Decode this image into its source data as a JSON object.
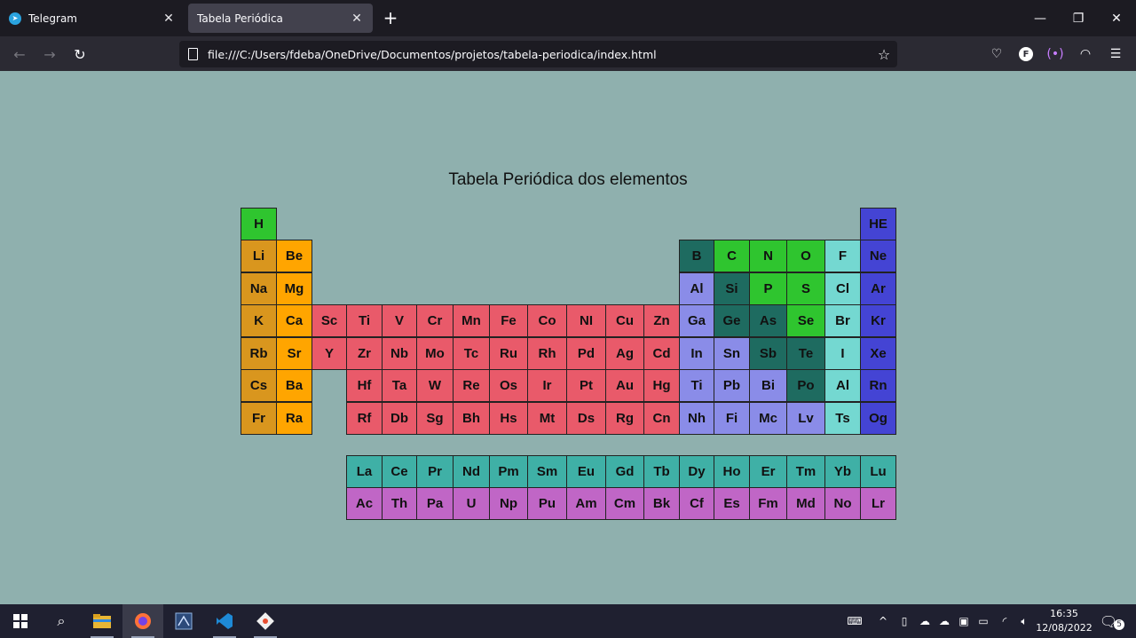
{
  "browser": {
    "tabs": [
      {
        "label": "Telegram",
        "active": false
      },
      {
        "label": "Tabela Periódica",
        "active": true
      }
    ],
    "url": "file:///C:/Users/fdeba/OneDrive/Documentos/projetos/tabela-periodica/index.html"
  },
  "page": {
    "title": "Tabela Periódica dos elementos"
  },
  "colors": {
    "page_background": "#8fb0ae",
    "nonmetal": "#2fc52f",
    "metalloid": "#1e6b60",
    "halogen": "#74d8d1",
    "noble_gas": "#4444d4",
    "alkali": "#d9961e",
    "alkaline_earth": "#ffa500",
    "transition": "#e95a6a",
    "post_transition": "#8a8ce8",
    "lanthanide": "#3fb0a6",
    "actinide": "#c066c6"
  },
  "table": {
    "main_rows": [
      [
        {
          "s": "H",
          "c": "nonmetal",
          "col": 1
        },
        {
          "s": "HE",
          "c": "noble_gas",
          "col": 18
        }
      ],
      [
        {
          "s": "Li",
          "c": "alkali",
          "col": 1
        },
        {
          "s": "Be",
          "c": "alkaline_earth",
          "col": 2
        },
        {
          "s": "B",
          "c": "metalloid",
          "col": 13
        },
        {
          "s": "C",
          "c": "nonmetal",
          "col": 14
        },
        {
          "s": "N",
          "c": "nonmetal",
          "col": 15
        },
        {
          "s": "O",
          "c": "nonmetal",
          "col": 16
        },
        {
          "s": "F",
          "c": "halogen",
          "col": 17
        },
        {
          "s": "Ne",
          "c": "noble_gas",
          "col": 18
        }
      ],
      [
        {
          "s": "Na",
          "c": "alkali",
          "col": 1
        },
        {
          "s": "Mg",
          "c": "alkaline_earth",
          "col": 2
        },
        {
          "s": "Al",
          "c": "post_transition",
          "col": 13
        },
        {
          "s": "Si",
          "c": "metalloid",
          "col": 14
        },
        {
          "s": "P",
          "c": "nonmetal",
          "col": 15
        },
        {
          "s": "S",
          "c": "nonmetal",
          "col": 16
        },
        {
          "s": "Cl",
          "c": "halogen",
          "col": 17
        },
        {
          "s": "Ar",
          "c": "noble_gas",
          "col": 18
        }
      ],
      [
        {
          "s": "K",
          "c": "alkali",
          "col": 1
        },
        {
          "s": "Ca",
          "c": "alkaline_earth",
          "col": 2
        },
        {
          "s": "Sc",
          "c": "transition",
          "col": 3
        },
        {
          "s": "Ti",
          "c": "transition",
          "col": 4
        },
        {
          "s": "V",
          "c": "transition",
          "col": 5
        },
        {
          "s": "Cr",
          "c": "transition",
          "col": 6
        },
        {
          "s": "Mn",
          "c": "transition",
          "col": 7
        },
        {
          "s": "Fe",
          "c": "transition",
          "col": 8
        },
        {
          "s": "Co",
          "c": "transition",
          "col": 9
        },
        {
          "s": "NI",
          "c": "transition",
          "col": 10
        },
        {
          "s": "Cu",
          "c": "transition",
          "col": 11
        },
        {
          "s": "Zn",
          "c": "transition",
          "col": 12
        },
        {
          "s": "Ga",
          "c": "post_transition",
          "col": 13
        },
        {
          "s": "Ge",
          "c": "metalloid",
          "col": 14
        },
        {
          "s": "As",
          "c": "metalloid",
          "col": 15
        },
        {
          "s": "Se",
          "c": "nonmetal",
          "col": 16
        },
        {
          "s": "Br",
          "c": "halogen",
          "col": 17
        },
        {
          "s": "Kr",
          "c": "noble_gas",
          "col": 18
        }
      ],
      [
        {
          "s": "Rb",
          "c": "alkali",
          "col": 1
        },
        {
          "s": "Sr",
          "c": "alkaline_earth",
          "col": 2
        },
        {
          "s": "Y",
          "c": "transition",
          "col": 3
        },
        {
          "s": "Zr",
          "c": "transition",
          "col": 4
        },
        {
          "s": "Nb",
          "c": "transition",
          "col": 5
        },
        {
          "s": "Mo",
          "c": "transition",
          "col": 6
        },
        {
          "s": "Tc",
          "c": "transition",
          "col": 7
        },
        {
          "s": "Ru",
          "c": "transition",
          "col": 8
        },
        {
          "s": "Rh",
          "c": "transition",
          "col": 9
        },
        {
          "s": "Pd",
          "c": "transition",
          "col": 10
        },
        {
          "s": "Ag",
          "c": "transition",
          "col": 11
        },
        {
          "s": "Cd",
          "c": "transition",
          "col": 12
        },
        {
          "s": "In",
          "c": "post_transition",
          "col": 13
        },
        {
          "s": "Sn",
          "c": "post_transition",
          "col": 14
        },
        {
          "s": "Sb",
          "c": "metalloid",
          "col": 15
        },
        {
          "s": "Te",
          "c": "metalloid",
          "col": 16
        },
        {
          "s": "I",
          "c": "halogen",
          "col": 17
        },
        {
          "s": "Xe",
          "c": "noble_gas",
          "col": 18
        }
      ],
      [
        {
          "s": "Cs",
          "c": "alkali",
          "col": 1
        },
        {
          "s": "Ba",
          "c": "alkaline_earth",
          "col": 2
        },
        {
          "s": "Hf",
          "c": "transition",
          "col": 4
        },
        {
          "s": "Ta",
          "c": "transition",
          "col": 5
        },
        {
          "s": "W",
          "c": "transition",
          "col": 6
        },
        {
          "s": "Re",
          "c": "transition",
          "col": 7
        },
        {
          "s": "Os",
          "c": "transition",
          "col": 8
        },
        {
          "s": "Ir",
          "c": "transition",
          "col": 9
        },
        {
          "s": "Pt",
          "c": "transition",
          "col": 10
        },
        {
          "s": "Au",
          "c": "transition",
          "col": 11
        },
        {
          "s": "Hg",
          "c": "transition",
          "col": 12
        },
        {
          "s": "Ti",
          "c": "post_transition",
          "col": 13
        },
        {
          "s": "Pb",
          "c": "post_transition",
          "col": 14
        },
        {
          "s": "Bi",
          "c": "post_transition",
          "col": 15
        },
        {
          "s": "Po",
          "c": "metalloid",
          "col": 16
        },
        {
          "s": "Al",
          "c": "halogen",
          "col": 17
        },
        {
          "s": "Rn",
          "c": "noble_gas",
          "col": 18
        }
      ],
      [
        {
          "s": "Fr",
          "c": "alkali",
          "col": 1
        },
        {
          "s": "Ra",
          "c": "alkaline_earth",
          "col": 2
        },
        {
          "s": "Rf",
          "c": "transition",
          "col": 4
        },
        {
          "s": "Db",
          "c": "transition",
          "col": 5
        },
        {
          "s": "Sg",
          "c": "transition",
          "col": 6
        },
        {
          "s": "Bh",
          "c": "transition",
          "col": 7
        },
        {
          "s": "Hs",
          "c": "transition",
          "col": 8
        },
        {
          "s": "Mt",
          "c": "transition",
          "col": 9
        },
        {
          "s": "Ds",
          "c": "transition",
          "col": 10
        },
        {
          "s": "Rg",
          "c": "transition",
          "col": 11
        },
        {
          "s": "Cn",
          "c": "transition",
          "col": 12
        },
        {
          "s": "Nh",
          "c": "post_transition",
          "col": 13
        },
        {
          "s": "Fi",
          "c": "post_transition",
          "col": 14
        },
        {
          "s": "Mc",
          "c": "post_transition",
          "col": 15
        },
        {
          "s": "Lv",
          "c": "post_transition",
          "col": 16
        },
        {
          "s": "Ts",
          "c": "halogen",
          "col": 17
        },
        {
          "s": "Og",
          "c": "noble_gas",
          "col": 18
        }
      ]
    ],
    "lanthanides": [
      "La",
      "Ce",
      "Pr",
      "Nd",
      "Pm",
      "Sm",
      "Eu",
      "Gd",
      "Tb",
      "Dy",
      "Ho",
      "Er",
      "Tm",
      "Yb",
      "Lu"
    ],
    "actinides": [
      "Ac",
      "Th",
      "Pa",
      "U",
      "Np",
      "Pu",
      "Am",
      "Cm",
      "Bk",
      "Cf",
      "Es",
      "Fm",
      "Md",
      "No",
      "Lr"
    ]
  },
  "taskbar": {
    "apps": [
      "start-icon",
      "search-icon",
      "file-explorer-icon",
      "firefox-icon",
      "ssms-icon",
      "vscode-icon",
      "git-icon"
    ],
    "time": "16:35",
    "date": "12/08/2022",
    "notification_count": "5"
  }
}
